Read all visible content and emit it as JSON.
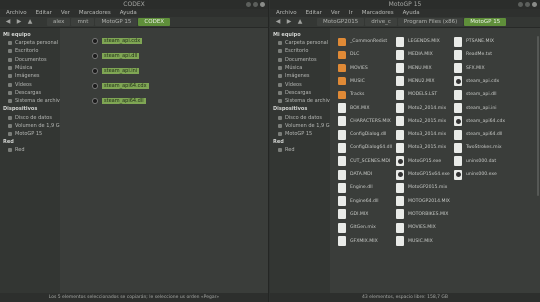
{
  "left": {
    "title": "CODEX",
    "menu": [
      "Archivo",
      "Editar",
      "Ver",
      "Marcadores",
      "Ayuda"
    ],
    "crumbs": [
      {
        "label": "alex",
        "active": false
      },
      {
        "label": "mnt",
        "active": false
      },
      {
        "label": "MotoGP 15",
        "active": false
      },
      {
        "label": "CODEX",
        "active": true
      }
    ],
    "sidebar": {
      "my_pc": "Mi equipo",
      "items": [
        "Carpeta personal",
        "Escritorio",
        "Documentos",
        "Música",
        "Imágenes",
        "Vídeos",
        "Descargas",
        "Sistema de archivos"
      ],
      "devices": "Dispositivos",
      "device_items": [
        "Disco de datos",
        "Volumen de 1,9 GB",
        "MotoGP 15"
      ],
      "net": "Red",
      "net_items": [
        "Red"
      ]
    },
    "files": [
      "steam_api.cdx",
      "steam_api.dll",
      "steam_api.ini",
      "steam_api64.cdx",
      "steam_api64.dll"
    ],
    "status": "Los 5 elementos seleccionados se copiarán; le seleccione us orden «Pegar»"
  },
  "right": {
    "title": "MotoGP 15",
    "menu": [
      "Archivo",
      "Editar",
      "Ver",
      "Ir",
      "Marcadores",
      "Ayuda"
    ],
    "crumbs": [
      {
        "label": "MotoGP2015",
        "active": false
      },
      {
        "label": "drive_c",
        "active": false
      },
      {
        "label": "Program Files (x86)",
        "active": false
      },
      {
        "label": "MotoGP 15",
        "active": true
      }
    ],
    "sidebar": {
      "my_pc": "Mi equipo",
      "items": [
        "Carpeta personal",
        "Escritorio",
        "Documentos",
        "Música",
        "Imágenes",
        "Vídeos",
        "Descargas",
        "Sistema de archivos"
      ],
      "devices": "Dispositivos",
      "device_items": [
        "Disco de datos",
        "Volumen de 1,9 GB",
        "MotoGP 15"
      ],
      "net": "Red",
      "net_items": [
        "Red"
      ]
    },
    "columns": [
      [
        {
          "name": "_CommonRedist",
          "kind": "folder"
        },
        {
          "name": "DLC",
          "kind": "folder"
        },
        {
          "name": "MOVIES",
          "kind": "folder"
        },
        {
          "name": "MUSIC",
          "kind": "folder"
        },
        {
          "name": "Tracks",
          "kind": "folder"
        },
        {
          "name": "BOX.MIX",
          "kind": "file"
        },
        {
          "name": "CHARACTERS.MIX",
          "kind": "file"
        },
        {
          "name": "ConfigDialog.dll",
          "kind": "file"
        },
        {
          "name": "ConfigDialog64.dll",
          "kind": "file"
        },
        {
          "name": "CUT_SCENES.MDI",
          "kind": "file"
        },
        {
          "name": "DATA.MDI",
          "kind": "file"
        },
        {
          "name": "Engine.dll",
          "kind": "file"
        },
        {
          "name": "Engine64.dll",
          "kind": "file"
        },
        {
          "name": "GDI.MIX",
          "kind": "file"
        },
        {
          "name": "GltGen.mix",
          "kind": "file"
        },
        {
          "name": "GFXMIX.MIX",
          "kind": "file"
        }
      ],
      [
        {
          "name": "LEGENDS.MIX",
          "kind": "file"
        },
        {
          "name": "MEDIA.MIX",
          "kind": "file"
        },
        {
          "name": "MENU.MIX",
          "kind": "file"
        },
        {
          "name": "MENU2.MIX",
          "kind": "file"
        },
        {
          "name": "MODELS.LST",
          "kind": "file"
        },
        {
          "name": "Moto2_2014.mix",
          "kind": "file"
        },
        {
          "name": "Moto2_2015.mix",
          "kind": "file"
        },
        {
          "name": "Moto3_2014.mix",
          "kind": "file"
        },
        {
          "name": "Moto3_2015.mix",
          "kind": "file"
        },
        {
          "name": "MotoGP15.exe",
          "kind": "gear"
        },
        {
          "name": "MotoGP15x64.exe",
          "kind": "gear"
        },
        {
          "name": "MotoGP2015.mix",
          "kind": "file"
        },
        {
          "name": "MOTOGP2014.MIX",
          "kind": "file"
        },
        {
          "name": "MOTORBIKES.MIX",
          "kind": "file"
        },
        {
          "name": "MOVIES.MIX",
          "kind": "file"
        },
        {
          "name": "MUSIC.MIX",
          "kind": "file"
        }
      ],
      [
        {
          "name": "PTSANE.MIX",
          "kind": "file"
        },
        {
          "name": "ReadMe.txt",
          "kind": "file"
        },
        {
          "name": "SFX.MIX",
          "kind": "file"
        },
        {
          "name": "steam_api.cdx",
          "kind": "gear"
        },
        {
          "name": "steam_api.dll",
          "kind": "file"
        },
        {
          "name": "steam_api.ini",
          "kind": "file"
        },
        {
          "name": "steam_api64.cdx",
          "kind": "gear"
        },
        {
          "name": "steam_api64.dll",
          "kind": "file"
        },
        {
          "name": "TwoStrokes.mix",
          "kind": "file"
        },
        {
          "name": "unins000.dat",
          "kind": "file"
        },
        {
          "name": "unins000.exe",
          "kind": "gear"
        }
      ]
    ],
    "status": "43 elementos, espacio libre: 158,7 GB"
  }
}
